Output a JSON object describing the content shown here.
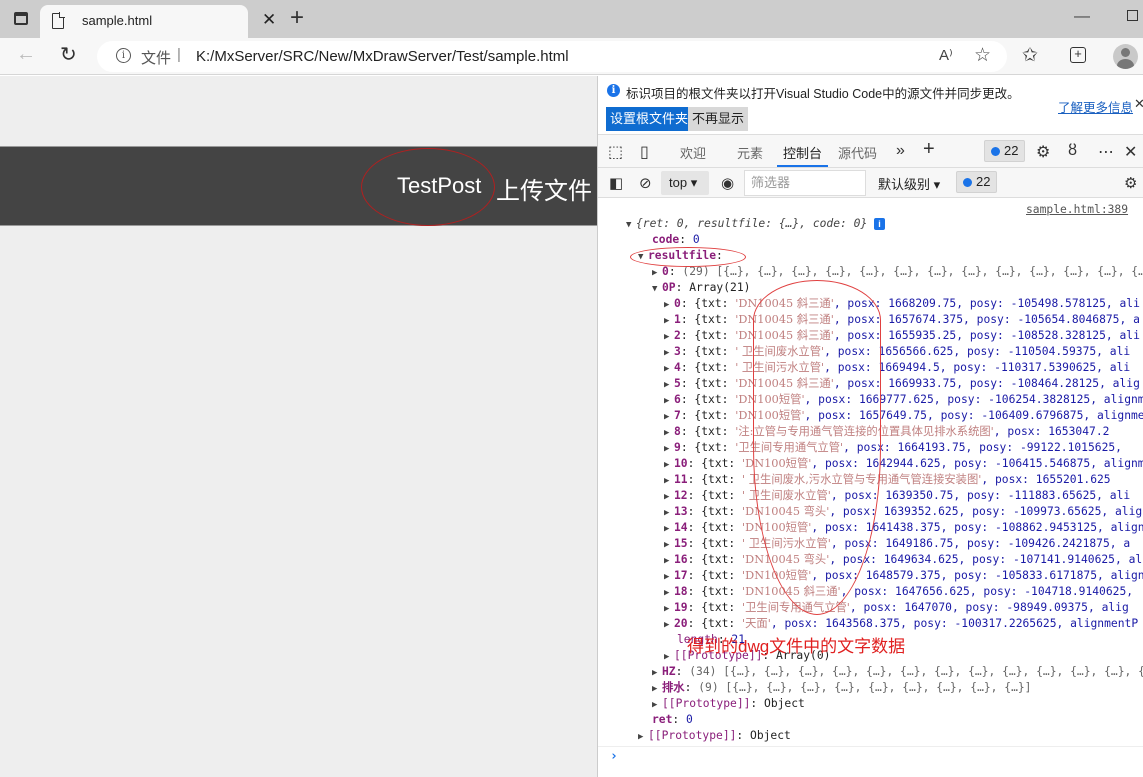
{
  "browser": {
    "tab_title": "sample.html",
    "address_scheme": "文件",
    "address_separator": "|",
    "url": "K:/MxServer/SRC/New/MxDrawServer/Test/sample.html",
    "read_aloud_label": "A⁾",
    "minimize_glyph": "—"
  },
  "page": {
    "testpost_label": "TestPost",
    "upload_label": "上传文件"
  },
  "devtools": {
    "infobar": {
      "message": "标识项目的根文件夹以打开Visual Studio Code中的源文件并同步更改。",
      "learn_more": "了解更多信息",
      "set_root_button": "设置根文件夹",
      "dont_show_button": "不再显示"
    },
    "tabs": [
      {
        "label": "欢迎",
        "active": false
      },
      {
        "label": "元素",
        "active": false
      },
      {
        "label": "控制台",
        "active": true
      },
      {
        "label": "源代码",
        "active": false
      }
    ],
    "issues_count": "22",
    "context_select": "top",
    "filter_placeholder": "筛选器",
    "level_select": "默认级别",
    "console": {
      "source_link": "sample.html:389",
      "summary": "{ret: 0, resultfile: {…}, code: 0}",
      "code_key": "code",
      "code_val": "0",
      "resultfile_key": "resultfile",
      "arr0_key": "0",
      "arr0_preview": "(29) [{…}, {…}, {…}, {…}, {…}, {…}, {…}, {…}, {…}, {…}, {…}, {…}, {…",
      "arr0p_key": "0P",
      "arr0p_type": "Array(21)",
      "items": [
        {
          "idx": "0",
          "txt": "'DN10045 斜三通'",
          "rest": ", posx: 1668209.75, posy: -105498.578125, ali"
        },
        {
          "idx": "1",
          "txt": "'DN10045 斜三通'",
          "rest": ", posx: 1657674.375, posy: -105654.8046875, a"
        },
        {
          "idx": "2",
          "txt": "'DN10045 斜三通'",
          "rest": ", posx: 1655935.25, posy: -108528.328125, ali"
        },
        {
          "idx": "3",
          "txt": "' 卫生间废水立管'",
          "rest": ", posx: 1656566.625, posy: -110504.59375, ali"
        },
        {
          "idx": "4",
          "txt": "' 卫生间污水立管'",
          "rest": ", posx: 1669494.5, posy: -110317.5390625, ali"
        },
        {
          "idx": "5",
          "txt": "'DN10045 斜三通'",
          "rest": ", posx: 1669933.75, posy: -108464.28125, alig"
        },
        {
          "idx": "6",
          "txt": "'DN100短管'",
          "rest": ", posx: 1669777.625, posy: -106254.3828125, alignm"
        },
        {
          "idx": "7",
          "txt": "'DN100短管'",
          "rest": ", posx: 1657649.75, posy: -106409.6796875, alignme"
        },
        {
          "idx": "8",
          "txt": "'注:立管与专用通气管连接的位置具体见排水系统图'",
          "rest": ", posx: 1653047.2"
        },
        {
          "idx": "9",
          "txt": "'卫生间专用通气立管'",
          "rest": ", posx: 1664193.75, posy: -99122.1015625,"
        },
        {
          "idx": "10",
          "txt": "'DN100短管'",
          "rest": ", posx: 1642944.625, posy: -106415.546875, alignm"
        },
        {
          "idx": "11",
          "txt": "' 卫生间废水,污水立管与专用通气管连接安装图'",
          "rest": ", posx: 1655201.625"
        },
        {
          "idx": "12",
          "txt": "' 卫生间废水立管'",
          "rest": ", posx: 1639350.75, posy: -111883.65625, ali"
        },
        {
          "idx": "13",
          "txt": "'DN10045 弯头'",
          "rest": ", posx: 1639352.625, posy: -109973.65625, alig"
        },
        {
          "idx": "14",
          "txt": "'DN100短管'",
          "rest": ", posx: 1641438.375, posy: -108862.9453125, align"
        },
        {
          "idx": "15",
          "txt": "' 卫生间污水立管'",
          "rest": ", posx: 1649186.75, posy: -109426.2421875, a"
        },
        {
          "idx": "16",
          "txt": "'DN10045 弯头'",
          "rest": ", posx: 1649634.625, posy: -107141.9140625, al"
        },
        {
          "idx": "17",
          "txt": "'DN100短管'",
          "rest": ", posx: 1648579.375, posy: -105833.6171875, align"
        },
        {
          "idx": "18",
          "txt": "'DN10045 斜三通'",
          "rest": ", posx: 1647656.625, posy: -104718.9140625,"
        },
        {
          "idx": "19",
          "txt": "'卫生间专用通气立管'",
          "rest": ", posx: 1647070, posy: -98949.09375, alig"
        },
        {
          "idx": "20",
          "txt": "'天面'",
          "rest": ", posx: 1643568.375, posy: -100317.2265625, alignmentP"
        }
      ],
      "length_key": "length",
      "length_val": "21",
      "proto_array": "[[Prototype]]",
      "proto_array_val": "Array(0)",
      "hz_key": "HZ",
      "hz_preview": "(34) [{…}, {…}, {…}, {…}, {…}, {…}, {…}, {…}, {…}, {…}, {…}, {…}, {",
      "ps_key": "排水",
      "ps_preview": "(9) [{…}, {…}, {…}, {…}, {…}, {…}, {…}, {…}, {…}]",
      "proto_object": "[[Prototype]]",
      "proto_object_val": "Object",
      "ret_key": "ret",
      "ret_val": "0",
      "outer_proto": "[[Prototype]]",
      "outer_proto_val": "Object"
    },
    "annotation_text": "得到的dwg文件中的文字数据"
  },
  "colors": {
    "accent": "#1a73e8",
    "annotation_red": "#e02020",
    "banner_bg": "#444444"
  }
}
